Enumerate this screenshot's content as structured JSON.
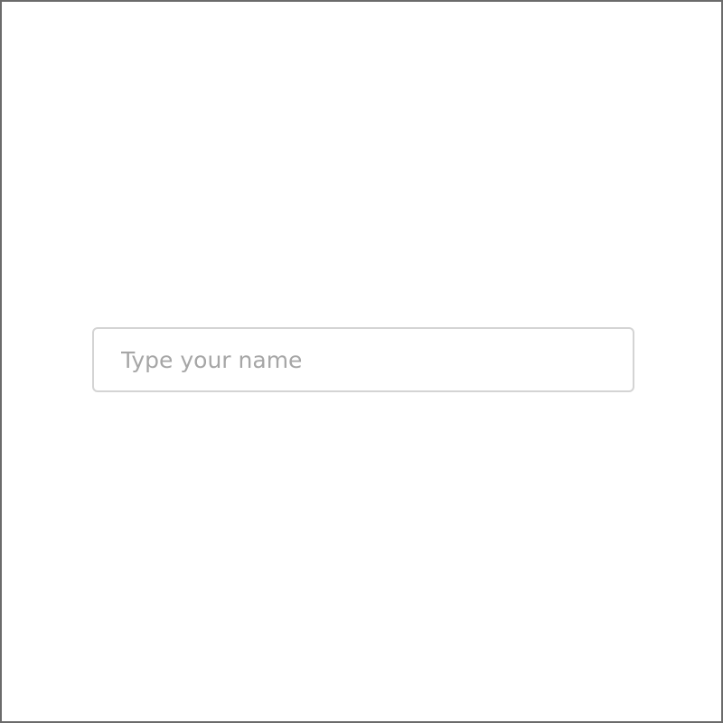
{
  "form": {
    "name_input": {
      "placeholder": "Type your name",
      "value": ""
    }
  },
  "colors": {
    "frame_border": "#6b6b6b",
    "input_border": "#d4d4d4",
    "placeholder_text": "#a6a6a6",
    "background": "#ffffff"
  }
}
